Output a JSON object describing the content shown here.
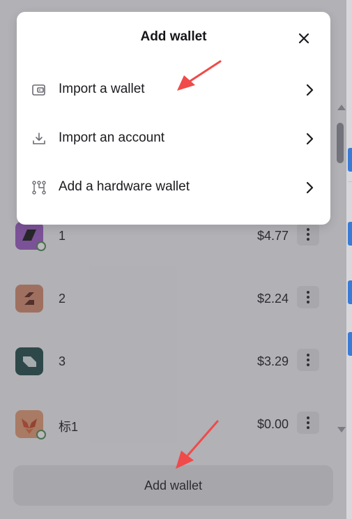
{
  "dialog": {
    "title": "Add wallet",
    "options": [
      {
        "label": "Import a wallet",
        "icon": "wallet-icon"
      },
      {
        "label": "Import an account",
        "icon": "download-icon"
      },
      {
        "label": "Add a hardware wallet",
        "icon": "hardware-wallet-icon"
      }
    ]
  },
  "wallets": [
    {
      "name": "1",
      "balance": "$4.77",
      "color": "#9b59c4",
      "connected": true
    },
    {
      "name": "2",
      "balance": "$2.24",
      "color": "#d58a6a",
      "connected": false
    },
    {
      "name": "3",
      "balance": "$3.29",
      "color": "#1f4a48",
      "connected": false
    },
    {
      "name": "标1",
      "balance": "$0.00",
      "color": "#e59a72",
      "connected": true
    }
  ],
  "footer": {
    "add_wallet_label": "Add wallet"
  },
  "annotations": {
    "arrow_color": "#f04a4a"
  }
}
